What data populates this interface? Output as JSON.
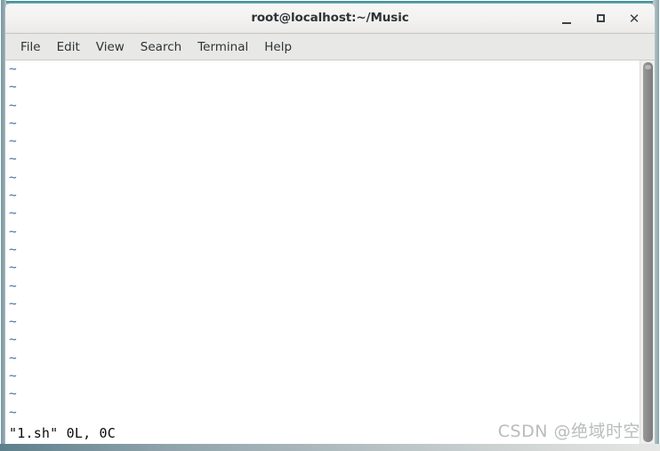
{
  "window": {
    "title": "root@localhost:~/Music",
    "controls": {
      "minimize": "_",
      "maximize": "□",
      "close": "✕"
    }
  },
  "menubar": {
    "items": [
      {
        "label": "File"
      },
      {
        "label": "Edit"
      },
      {
        "label": "View"
      },
      {
        "label": "Search"
      },
      {
        "label": "Terminal"
      },
      {
        "label": "Help"
      }
    ]
  },
  "terminal": {
    "program": "vim",
    "empty_line_marker": "~",
    "empty_line_count": 20,
    "status_line": "\"1.sh\" 0L, 0C",
    "tilde_color": "#4a6fa5",
    "background_color": "#ffffff",
    "foreground_color": "#0b0b0b"
  },
  "scrollbar": {
    "orientation": "vertical",
    "position": "right"
  },
  "watermark": {
    "text": "CSDN @绝域时空"
  },
  "theme": {
    "titlebar_bg": "#f2f1f0",
    "menubar_bg": "#e8e8e6",
    "border_accent": "#3e8f96",
    "text_color": "#2e3436"
  }
}
